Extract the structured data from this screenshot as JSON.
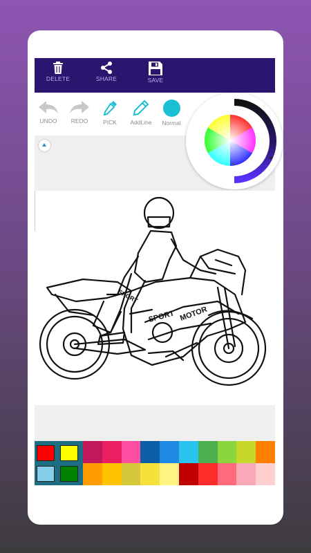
{
  "toolbar": {
    "delete_label": "DELETE",
    "share_label": "SHARE",
    "save_label": "SAVE"
  },
  "tools": {
    "undo_label": "UNDO",
    "redo_label": "REDO",
    "pick_label": "PICK",
    "addline_label": "AddLine",
    "normal_label": "Normal"
  },
  "colors": {
    "toolbar_bg": "#2a166e",
    "current_color": "#1bbfd3",
    "primary": "#ff0000",
    "secondary": "#ffff00",
    "tertiary": "#87ceeb",
    "quaternary": "#008000"
  },
  "palette": [
    [
      "#c2185b",
      "#e91e63",
      "#ff4fa3",
      "#0b5fa5",
      "#1e88e5",
      "#29c3f0",
      "#4caf50",
      "#8bd63f",
      "#c6d62a",
      "#ff7f00"
    ],
    [
      "#ff9c00",
      "#ffc200",
      "#d7c73a",
      "#f6e03b",
      "#fff481",
      "#c00000",
      "#ff2b2b",
      "#ff6b7a",
      "#f9a8b8",
      "#ffcfcf"
    ]
  ],
  "drawing": {
    "text_1": "SPORT",
    "text_2": "SPORT",
    "text_3": "MOTOR"
  }
}
